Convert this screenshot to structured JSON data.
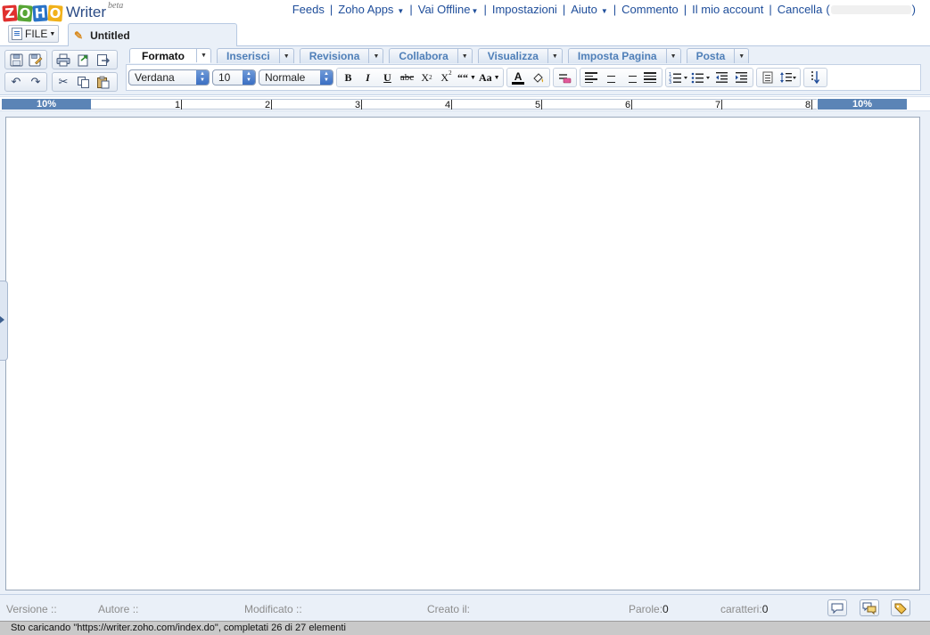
{
  "app": {
    "logo_letters": [
      "Z",
      "O",
      "H",
      "O"
    ],
    "name": "Writer",
    "beta": "beta"
  },
  "top_links": [
    {
      "label": "Feeds",
      "dropdown": false
    },
    {
      "label": "Zoho Apps",
      "dropdown": true
    },
    {
      "label": "Vai Offline",
      "dropdown": true
    },
    {
      "label": "Impostazioni",
      "dropdown": false
    },
    {
      "label": "Aiuto",
      "dropdown": true
    },
    {
      "label": "Commento",
      "dropdown": false
    },
    {
      "label": "Il mio account",
      "dropdown": false
    },
    {
      "label": "Cancella",
      "dropdown": false
    }
  ],
  "cancella_paren_open": "(",
  "cancella_paren_close": ")",
  "file_menu": {
    "label": "FILE"
  },
  "document_tab": {
    "title": "Untitled"
  },
  "ribbon_tabs": [
    {
      "label": "Formato",
      "active": true
    },
    {
      "label": "Inserisci",
      "active": false
    },
    {
      "label": "Revisiona",
      "active": false
    },
    {
      "label": "Collabora",
      "active": false
    },
    {
      "label": "Visualizza",
      "active": false
    },
    {
      "label": "Imposta Pagina",
      "active": false
    },
    {
      "label": "Posta",
      "active": false
    }
  ],
  "format": {
    "font_family": "Verdana",
    "font_size": "10",
    "paragraph_style": "Normale",
    "bold": "B",
    "italic": "I",
    "underline": "U",
    "strike": "abc",
    "subscript": "X",
    "superscript": "X",
    "quote": "““",
    "case": "Aa",
    "font_color": "A"
  },
  "ruler": {
    "left_margin": "10%",
    "right_margin": "10%",
    "ticks": [
      "1",
      "2",
      "3",
      "4",
      "5",
      "6",
      "7",
      "8"
    ]
  },
  "info": {
    "version_label": "Versione ::",
    "author_label": "Autore ::",
    "modified_label": "Modificato ::",
    "created_label": "Creato il:",
    "words_label": "Parole:",
    "words_value": "0",
    "chars_label": "caratteri:",
    "chars_value": "0"
  },
  "status": "Sto caricando \"https://writer.zoho.com/index.do\", completati 26 di 27 elementi",
  "colors": {
    "link": "#1e4d9a",
    "tab_label": "#4f7fb8",
    "ruler_margin": "#5b84b6",
    "panel_bg": "#eaf0f8"
  }
}
